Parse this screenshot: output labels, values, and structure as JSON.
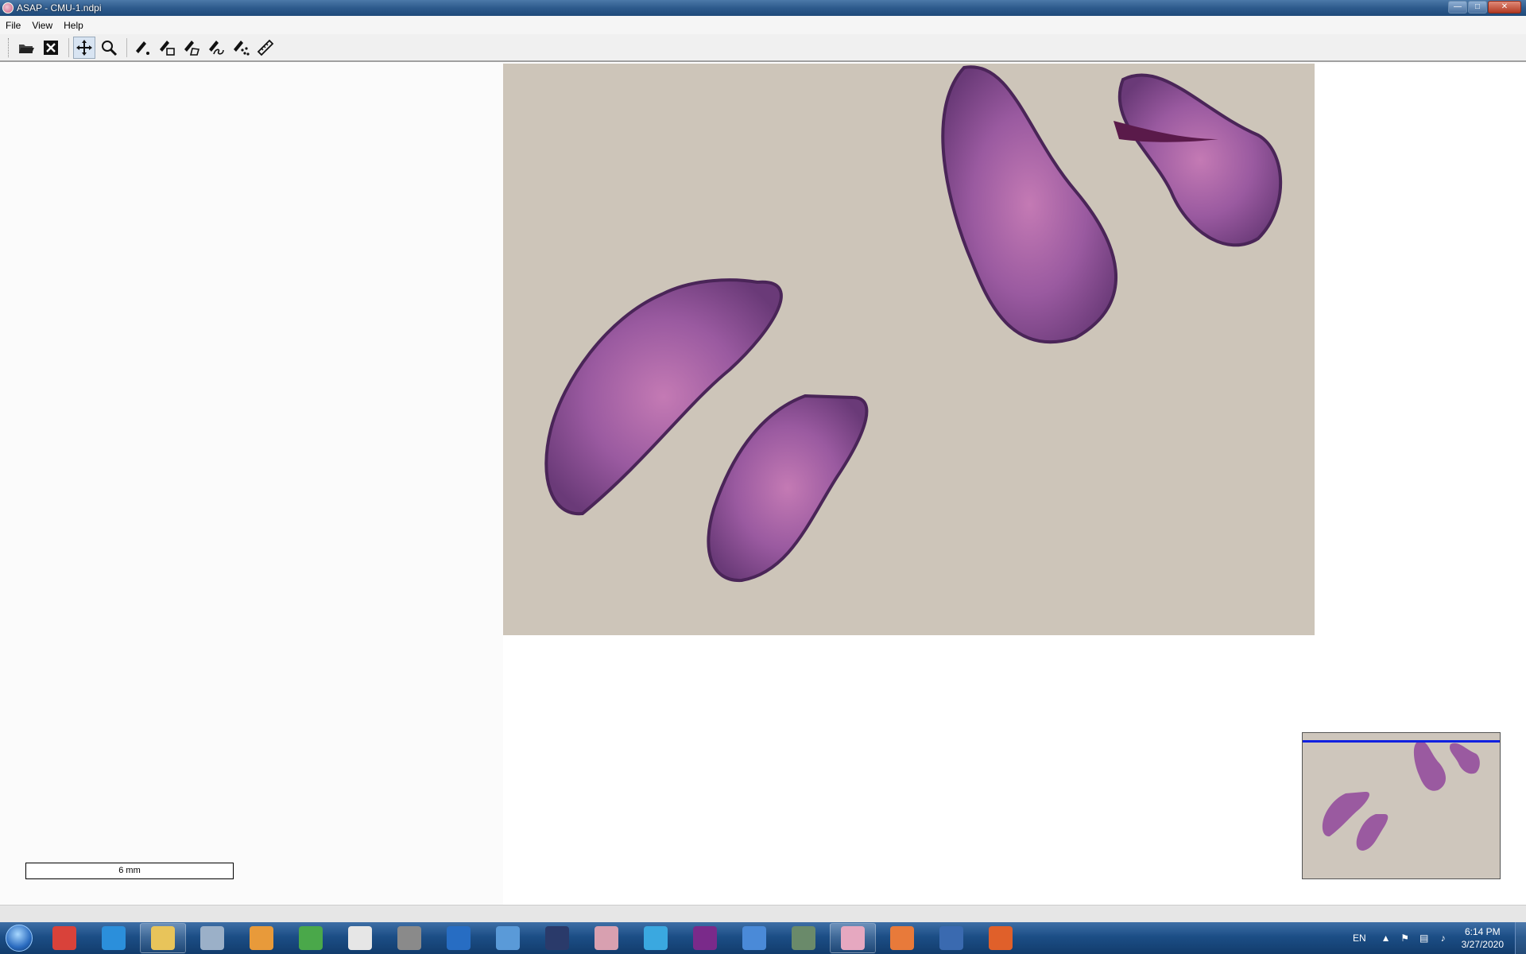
{
  "window": {
    "title": "ASAP - CMU-1.ndpi",
    "controls": [
      "minimize",
      "maximize",
      "close"
    ]
  },
  "menu": {
    "items": [
      "File",
      "View",
      "Help"
    ]
  },
  "toolbar": {
    "tools": [
      {
        "name": "open",
        "icon": "folder-open-icon"
      },
      {
        "name": "close",
        "icon": "close-box-icon"
      },
      {
        "name": "pan",
        "icon": "move-arrows-icon",
        "active": true
      },
      {
        "name": "zoom",
        "icon": "magnifier-icon"
      },
      {
        "name": "dot-annotation",
        "icon": "pen-dot-icon"
      },
      {
        "name": "rectangle-annotation",
        "icon": "pen-rectangle-icon"
      },
      {
        "name": "polygon-annotation",
        "icon": "pen-polygon-icon"
      },
      {
        "name": "spline-annotation",
        "icon": "pen-spline-icon"
      },
      {
        "name": "point-set-annotation",
        "icon": "pen-pointset-icon"
      },
      {
        "name": "measurement",
        "icon": "ruler-icon"
      }
    ]
  },
  "scalebar": {
    "label": "6 mm"
  },
  "colors": {
    "slide_background": "#cdc5b9",
    "tissue_primary": "#9a4f99",
    "tissue_pink": "#c86aa8",
    "tissue_dark": "#5a2a60",
    "minimap_viewport": "#1020e0"
  },
  "taskbar": {
    "apps": [
      {
        "name": "chrome",
        "icon": "chrome-icon",
        "color": "#d9423a"
      },
      {
        "name": "internet-explorer",
        "icon": "ie-icon",
        "color": "#2b8fdb"
      },
      {
        "name": "explorer",
        "icon": "folder-icon",
        "color": "#e8c45a",
        "pinned": true
      },
      {
        "name": "calculator",
        "icon": "calculator-icon",
        "color": "#9bb0c8"
      },
      {
        "name": "sound",
        "icon": "speaker-icon",
        "color": "#e89a3a"
      },
      {
        "name": "app-cubes",
        "icon": "cubes-icon",
        "color": "#4aa84a"
      },
      {
        "name": "mu",
        "icon": "mu-icon",
        "color": "#e6e6e6"
      },
      {
        "name": "microscope",
        "icon": "microscope-icon",
        "color": "#8a8a8a"
      },
      {
        "name": "r",
        "icon": "r-icon",
        "color": "#276dc3"
      },
      {
        "name": "paint",
        "icon": "paint-icon",
        "color": "#5a9ad8"
      },
      {
        "name": "zen",
        "icon": "zen-icon",
        "color": "#2a3a6a"
      },
      {
        "name": "qupath",
        "icon": "qupath-icon",
        "color": "#d8a0b0"
      },
      {
        "name": "triangle-app",
        "icon": "triangle-icon",
        "color": "#3aa8e0"
      },
      {
        "name": "cellprofiler",
        "icon": "cat-icon",
        "color": "#7a2a8a"
      },
      {
        "name": "search-app",
        "icon": "magnifier-icon",
        "color": "#4a8ad8"
      },
      {
        "name": "globe-app",
        "icon": "globe-icon",
        "color": "#6a8a6a"
      },
      {
        "name": "asap",
        "icon": "asap-icon",
        "color": "#e6a8c0",
        "pinned": true
      },
      {
        "name": "fiji",
        "icon": "fiji-icon",
        "color": "#e87a3a"
      },
      {
        "name": "remote",
        "icon": "remote-desktop-icon",
        "color": "#3a6ab0"
      },
      {
        "name": "matlab",
        "icon": "matlab-icon",
        "color": "#e0602a"
      }
    ]
  },
  "tray": {
    "language": "EN",
    "time": "6:14 PM",
    "date": "3/27/2020"
  }
}
